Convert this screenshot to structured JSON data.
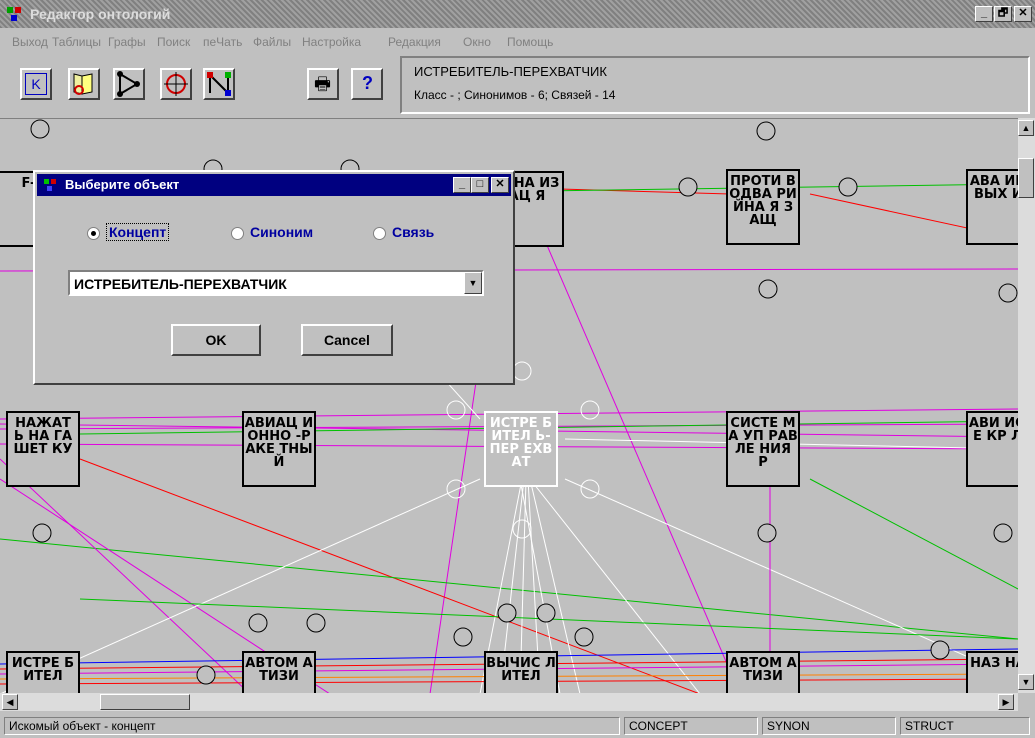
{
  "window": {
    "title": "Редактор онтологий",
    "min": "_",
    "max": "🗗",
    "close": "✕"
  },
  "menu": [
    "Выход",
    "Таблицы",
    "Графы",
    "Поиск",
    "пеЧать",
    "Файлы",
    "Настройка",
    "Редакция",
    "Окно",
    "Помощь"
  ],
  "toolbar": {
    "concept_btn": "K",
    "help_btn": "?",
    "print_btn": "🖶"
  },
  "info": {
    "title": "ИСТРЕБИТЕЛЬ-ПЕРЕХВАТЧИК",
    "stats": "Класс - ; Синонимов -   6; Связей -   14"
  },
  "nodes": [
    {
      "id": "n1",
      "label": "F-4"
    },
    {
      "id": "n2",
      "label": "ИГНА ИЗАЦ Я"
    },
    {
      "id": "n3",
      "label": "ПРОТИ ВОДВА РИЙНА Я ЗАЩ"
    },
    {
      "id": "n4",
      "label": "АВА ИНЬ ВЫХ ИЗ"
    },
    {
      "id": "n5",
      "label": "НАЖАТ Ь НА ГАШЕТ КУ"
    },
    {
      "id": "n6",
      "label": "АВИАЦ ИОННО -РАКЕ ТНЫЙ"
    },
    {
      "id": "n7",
      "label": "ИСТРЕ БИТЕЛ Ь-ПЕР ЕХВАТ"
    },
    {
      "id": "n8",
      "label": "СИСТЕ МА УП РАВЛЕ НИЯ Р"
    },
    {
      "id": "n9",
      "label": "АВИ ИОН Е КР ЛО"
    },
    {
      "id": "n10",
      "label": "ИСТРЕ БИТЕЛ"
    },
    {
      "id": "n11",
      "label": "АВТОМ АТИЗИ"
    },
    {
      "id": "n12",
      "label": "ВЫЧИС ЛИТЕЛ"
    },
    {
      "id": "n13",
      "label": "АВТОМ АТИЗИ"
    },
    {
      "id": "n14",
      "label": "НАЗ НАЯ"
    }
  ],
  "dialog": {
    "title": "Выберите объект",
    "radios": [
      "Концепт",
      "Синоним",
      "Связь"
    ],
    "selected_radio": "Концепт",
    "combo_value": "ИСТРЕБИТЕЛЬ-ПЕРЕХВАТЧИК",
    "ok": "OK",
    "cancel": "Cancel",
    "title_buttons": {
      "min": "_",
      "max": "□",
      "close": "✕"
    }
  },
  "status": {
    "message": "Искомый объект - концепт",
    "concept": "CONCEPT",
    "synon": "SYNON",
    "struct": "STRUCT"
  },
  "colors": {
    "red": "#ff0000",
    "green": "#00c000",
    "magenta": "#e000e0",
    "white": "#ffffff",
    "blue": "#0000ff"
  }
}
